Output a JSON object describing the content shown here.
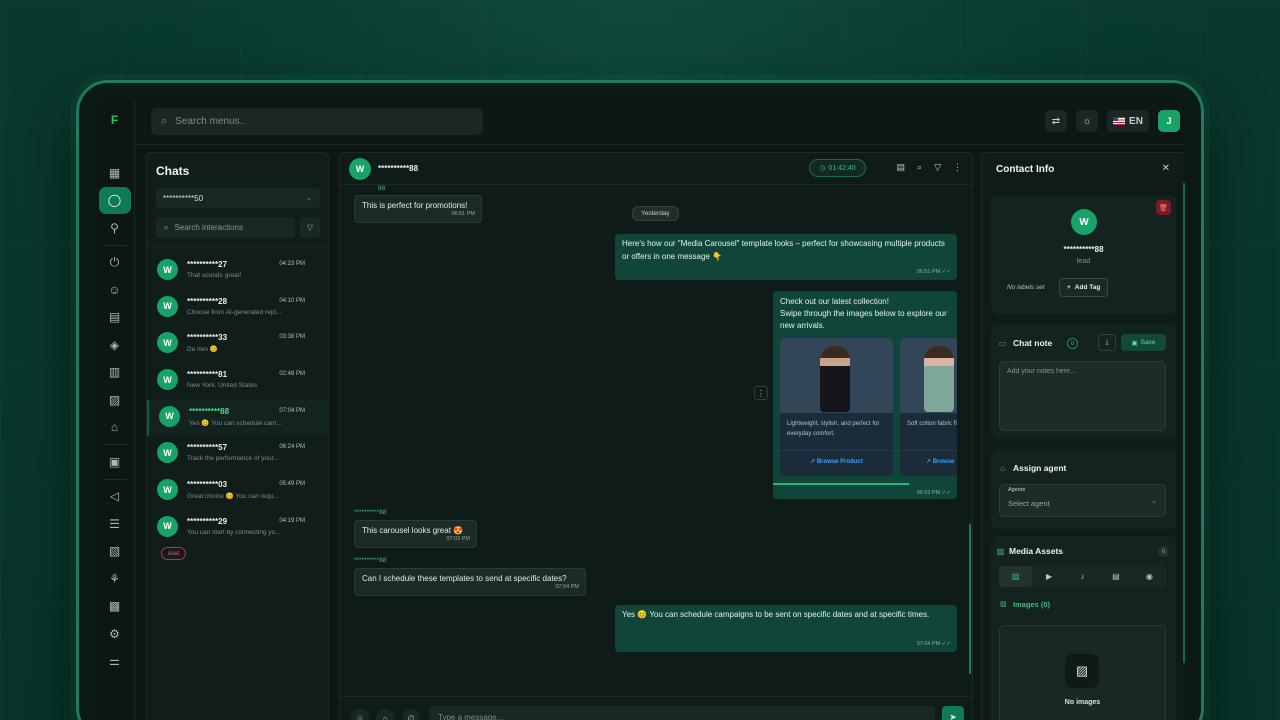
{
  "rail": {
    "logo": "F",
    "icons": [
      "dashboard-icon",
      "chat-icon",
      "flow-icon",
      "plug-icon",
      "contacts-icon",
      "templates-icon",
      "tag-icon",
      "book-icon",
      "image-icon",
      "bot-icon",
      "billing-icon",
      "megaphone-icon",
      "list-icon",
      "report-icon",
      "webhook-icon",
      "id-card-icon",
      "gear-icon",
      "toggle-settings-icon"
    ],
    "active_index": 1
  },
  "topbar": {
    "search_placeholder": "Search menus..",
    "lang": "EN",
    "user_initial": "J"
  },
  "chats": {
    "title": "Chats",
    "account": "**********50",
    "search_placeholder": "Search interactions",
    "items": [
      {
        "initial": "W",
        "name": "**********27",
        "time": "04:23 PM",
        "preview": "That sounds great!"
      },
      {
        "initial": "W",
        "name": "**********28",
        "time": "04:10 PM",
        "preview": "Choose from AI-generated repl..."
      },
      {
        "initial": "W",
        "name": "**********33",
        "time": "03:38 PM",
        "preview": "De rien 😊"
      },
      {
        "initial": "W",
        "name": "**********81",
        "time": "02:48 PM",
        "preview": "New York, United States"
      },
      {
        "initial": "W",
        "name": "**********88",
        "time": "07:04 PM",
        "preview": "Yes 😊 You can schedule cam..."
      },
      {
        "initial": "W",
        "name": "**********57",
        "time": "06:24 PM",
        "preview": "Track the performance of your..."
      },
      {
        "initial": "W",
        "name": "**********03",
        "time": "05:49 PM",
        "preview": "Great choice 😊 You can requ..."
      },
      {
        "initial": "W",
        "name": "**********29",
        "time": "04:19 PM",
        "preview": "You can start by connecting yo..."
      }
    ],
    "selected_index": 4,
    "tag": "lead"
  },
  "conversation": {
    "contact_initial": "W",
    "contact_name": "**********88",
    "timer": "01:42:40",
    "top_sender": "88",
    "date_divider": "Yesterday",
    "messages": {
      "m1": {
        "text": "This is perfect for promotions!",
        "time": "06:51 PM"
      },
      "m2": {
        "text": "Here's how our \"Media Carousel\" template looks – perfect for showcasing multiple products or offers in one message 👇",
        "time": "06:51 PM ✓✓"
      },
      "m3": {
        "intro": "Check out our latest collection!\nSwipe through the images below to explore our new arrivals.",
        "time": "06:53 PM ✓✓"
      },
      "m4_sender": "**********88",
      "m4": {
        "text": "This carousel looks great 😍",
        "time": "07:03 PM"
      },
      "m5_sender": "**********88",
      "m5": {
        "text": "Can I schedule these templates to send at specific dates?",
        "time": "07:04 PM"
      },
      "m6": {
        "text": "Yes 😊 You can schedule campaigns to be sent on specific dates and at specific times.",
        "time": "07:04 PM ✓✓"
      }
    },
    "cards": [
      {
        "desc": "Lightweight, stylish, and perfect for everyday comfort.",
        "button": "Browse Product"
      },
      {
        "desc": "Soft cotton fabric fit – perfect for da",
        "button": "Browse"
      }
    ],
    "composer_placeholder": "Type a message..."
  },
  "contact": {
    "title": "Contact Info",
    "initial": "W",
    "name": "**********88",
    "role": "lead",
    "no_labels": "No labels set",
    "add_tag": "Add Tag",
    "note": {
      "title": "Chat note",
      "count": "0",
      "save": "Save",
      "placeholder": "Add your notes here..."
    },
    "agent": {
      "title": "Assign agent",
      "field_label": "Agents",
      "placeholder": "Select agent"
    },
    "media": {
      "title": "Media Assets",
      "count": "0",
      "images_label": "Images (0)",
      "empty": "No images"
    }
  },
  "colors": {
    "accent": "#17a368",
    "bubble_out": "#10463a",
    "bubble_in": "#1d2b28",
    "link": "#3aa0ff",
    "danger": "#e05252"
  }
}
